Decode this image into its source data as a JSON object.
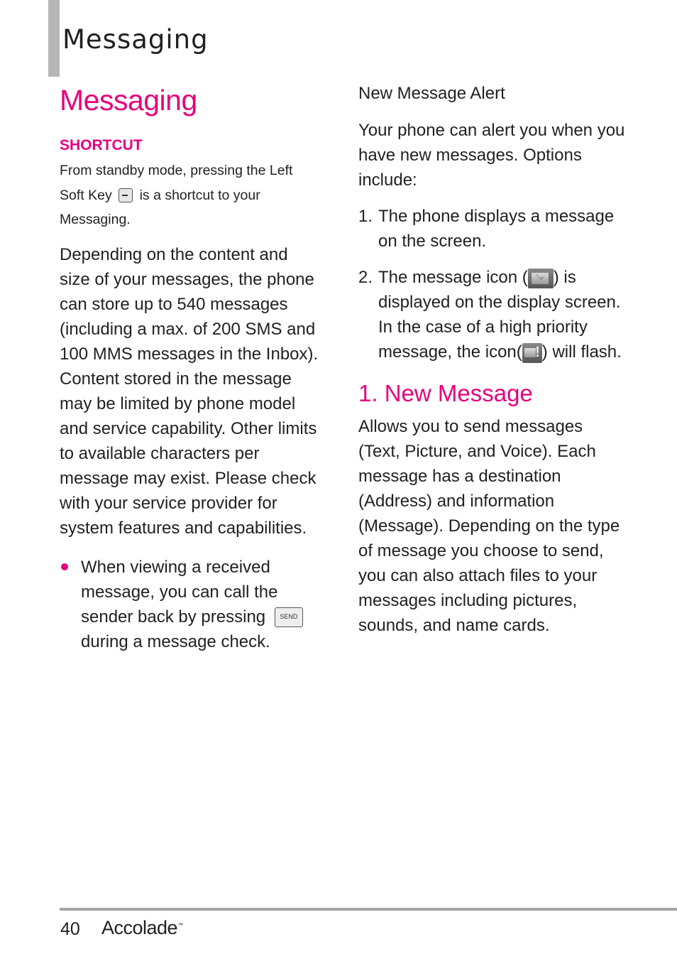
{
  "header": {
    "section_title": "Messaging"
  },
  "left": {
    "title": "Messaging",
    "shortcut_label": "SHORTCUT",
    "shortcut_text_1": "From standby mode, pressing the Left",
    "shortcut_text_2a": "Soft Key",
    "shortcut_text_2b": "is a shortcut to your",
    "shortcut_text_3": "Messaging.",
    "body": "Depending on the content and size of your messages, the phone can store up to 540 messages (including a max. of 200 SMS and 100 MMS messages in the Inbox). Content stored in the message may be limited by phone model and service capability. Other limits to available characters per message may exist. Please check with your service provider for system features and capabilities.",
    "bullet_a": "When viewing a received message, you can call the sender back by pressing",
    "bullet_send_key": "SEND",
    "bullet_b": "during a message check."
  },
  "right": {
    "alert_heading": "New Message Alert",
    "alert_intro": "Your phone can alert you when you have new messages. Options include:",
    "options": [
      {
        "num": "1.",
        "text": "The phone displays a message on the screen."
      },
      {
        "num": "2.",
        "text_a": "The message icon (",
        "text_b": ") is displayed on the display screen. In the case of a high priority message, the icon(",
        "text_c": ") will flash."
      }
    ],
    "new_message_title": "1. New Message",
    "new_message_body": "Allows you to send messages (Text, Picture, and Voice). Each message has a destination (Address) and information (Message). Depending on the type of message you choose to send, you can also attach files to your messages including pictures, sounds, and name cards."
  },
  "footer": {
    "page_number": "40",
    "brand": "Accolade",
    "trademark": "™"
  },
  "colors": {
    "accent": "#e6007e",
    "header_bar": "#b7b7b7",
    "footer_rule": "#a6a6a6",
    "text": "#231f20"
  }
}
